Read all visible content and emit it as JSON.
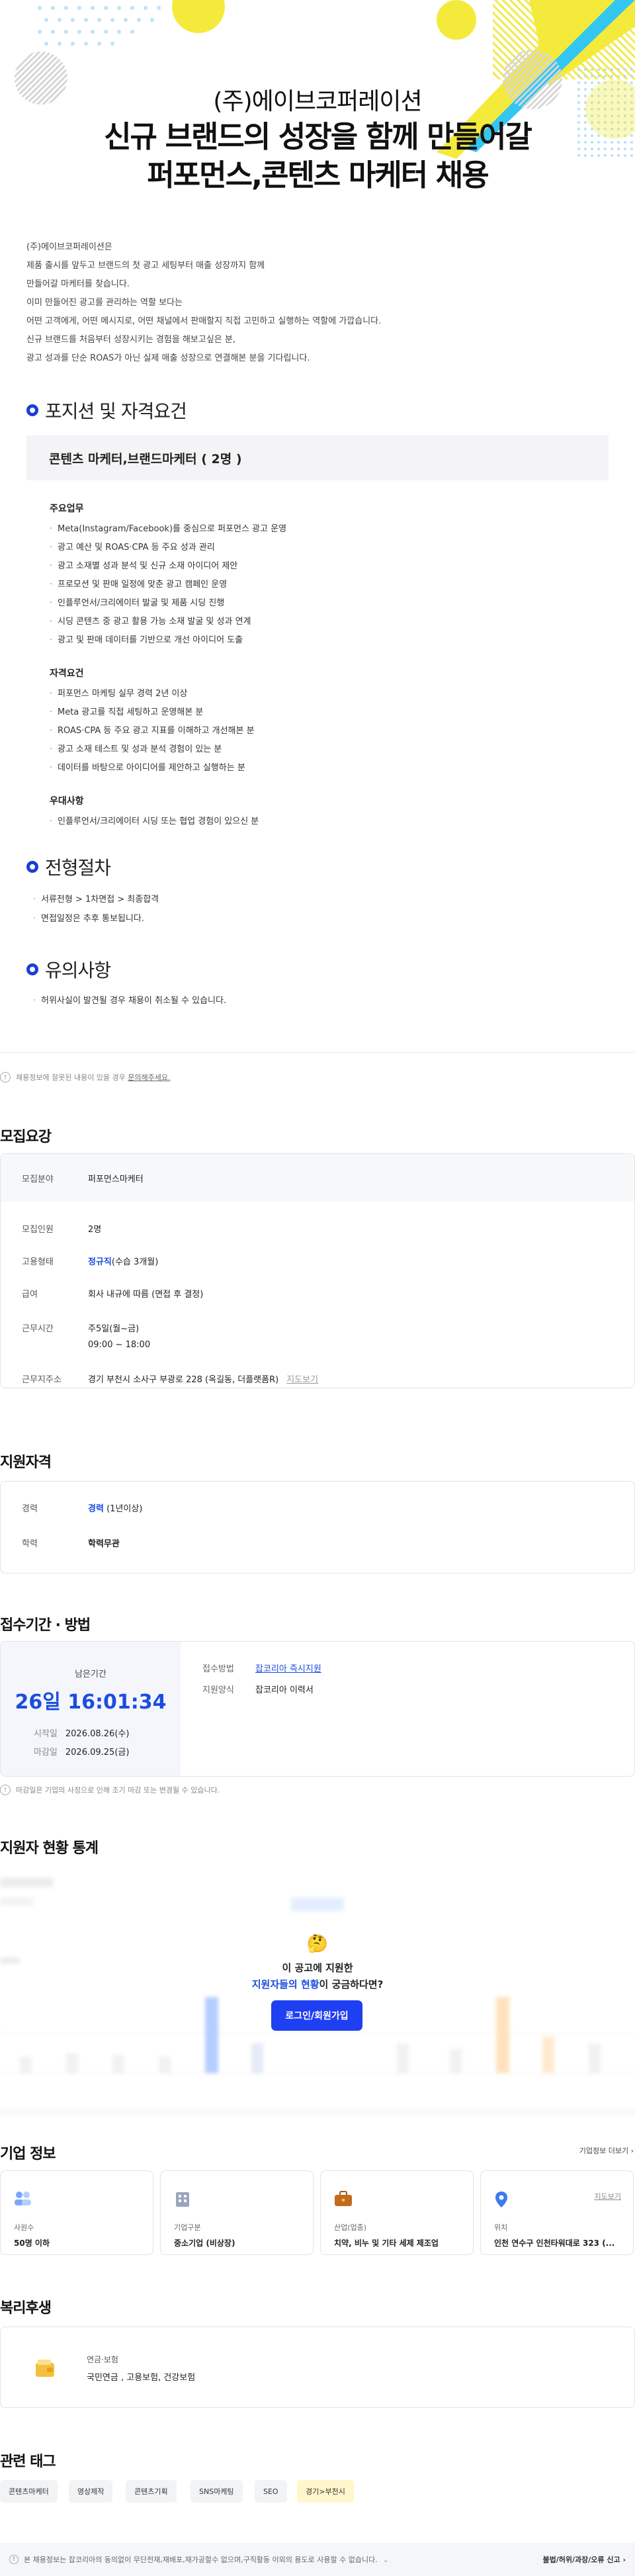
{
  "banner": {
    "company": "(주)에이브코퍼레이션",
    "headline_line1": "신규 브랜드의 성장을 함께 만들어갈",
    "headline_line2": "퍼포먼스,콘텐츠 마케터 채용"
  },
  "intro": {
    "lines": [
      "(주)에이브코퍼레이션은",
      "제품 출시를 앞두고 브랜드의 첫 광고 세팅부터 매출 성장까지 함께",
      "만들어갈 마케터를 찾습니다.",
      "이미 만들어진 광고를 관리하는 역할 보다는",
      "어떤 고객에게, 어떤 메시지로, 어떤 채널에서 판매할지 직접 고민하고 실행하는 역할에 가깝습니다.",
      "신규 브랜드를 처음부터 성장시키는 경험을 해보고싶은 분,",
      "광고 성과를 단순 ROAS가 아닌 실제 매출 성장으로 연결해본 분을 기다립니다."
    ]
  },
  "positions": {
    "heading": "포지션 및 자격요건",
    "role": "콘텐츠 마케터,브랜드마케터 ( 2명 )",
    "duties_title": "주요업무",
    "duties": [
      "Meta(Instagram/Facebook)를 중심으로 퍼포먼스 광고 운영",
      "광고 예산 및 ROAS·CPA 등 주요 성과 관리",
      "광고 소재별 성과 분석 및 신규 소재 아이디어 제안",
      "프로모션 및 판매 일정에 맞춘 광고 캠페인 운영",
      "인플루언서/크리에이터 발굴 및 제품 시딩 진행",
      "시딩 콘텐츠 중 광고 활용 가능 소재 발굴 및 성과 연계",
      "광고 및 판매 데이터를 기반으로 개선 아이디어 도출"
    ],
    "quals_title": "자격요건",
    "quals": [
      "퍼포먼스 마케팅 실무 경력 2년 이상",
      "Meta 광고를 직접 세팅하고 운영해본 분",
      "ROAS·CPA 등 주요 광고 지표를 이해하고 개선해본 분",
      "광고 소재 테스트 및 성과 분석 경험이 있는 분",
      "데이터를 바탕으로 아이디어를 제안하고 실행하는 분"
    ],
    "pref_title": "우대사항",
    "prefs": [
      "인플루언서/크리에이터 시딩 또는 협업 경험이 있으신 분"
    ]
  },
  "process": {
    "heading": "전형절차",
    "items": [
      "서류전형 > 1차면접 > 최종합격",
      "면접일정은 추후 통보됩니다."
    ]
  },
  "caution": {
    "heading": "유의사항",
    "items": [
      "허위사실이 발견될 경우 채용이 취소될 수 있습니다."
    ]
  },
  "report_notice": {
    "text": "채용정보에 잘못된 내용이 있을 경우",
    "link": "문의해주세요."
  },
  "summary": {
    "title": "모집요강",
    "field_k": "모집분야",
    "field_v": "퍼포먼스마케터",
    "count_k": "모집인원",
    "count_v": "2명",
    "type_k": "고용형태",
    "type_v": "정규직",
    "type_sub": "(수습 3개월)",
    "pay_k": "급여",
    "pay_v": "회사 내규에 따름 (면접 후 결정)",
    "hours_k": "근무시간",
    "hours_v1": "주5일(월~금)",
    "hours_v2": "09:00 ~ 18:00",
    "addr_k": "근무지주소",
    "addr_v": "경기 부천시 소사구 부광로 228 (옥길동, 더플랫폼R)",
    "addr_link": "지도보기"
  },
  "qualification": {
    "title": "지원자격",
    "career_k": "경력",
    "career_v": "경력",
    "career_sub": "(1년이상)",
    "edu_k": "학력",
    "edu_v": "학력무관"
  },
  "apply": {
    "title": "접수기간 · 방법",
    "remain_label": "남은기간",
    "remain": "26일 16:01:34",
    "start_k": "시작일",
    "start_v": "2026.08.26(수)",
    "end_k": "마감일",
    "end_v": "2026.09.25(금)",
    "method_k": "접수방법",
    "method_v": "잡코리아 즉시지원",
    "form_k": "지원양식",
    "form_v": "잡코리아 이력서",
    "notice": "마감일은 기업의 사정으로 인해 조기 마감 또는 변경될 수 있습니다."
  },
  "stats": {
    "title": "지원자 현황 통계",
    "emoji": "🤔",
    "q1": "이 공고에 지원한",
    "q2_hl": "지원자들의 현황",
    "q2_rest": "이 궁금하다면?",
    "button": "로그인/회원가입"
  },
  "company": {
    "title": "기업 정보",
    "more": "기업정보 더보기",
    "map_link": "지도보기",
    "cards": [
      {
        "icon": "people-icon",
        "label": "사원수",
        "value": "50명 이하"
      },
      {
        "icon": "building-icon",
        "label": "기업구분",
        "value": "중소기업 (비상장)"
      },
      {
        "icon": "briefcase-icon",
        "label": "산업(업종)",
        "value": "치약, 비누 및 기타 세제 제조업"
      },
      {
        "icon": "pin-icon",
        "label": "위치",
        "value": "인천 연수구 인천타워대로 323 (..."
      }
    ]
  },
  "welfare": {
    "title": "복리후생",
    "category": "연금·보험",
    "items": "국민연금 , 고용보험, 건강보험"
  },
  "tags": {
    "title": "관련 태그",
    "items": [
      "콘텐츠마케터",
      "영상제작",
      "콘텐츠기획",
      "SNS마케팅",
      "SEO",
      "경기>부천시"
    ]
  },
  "footer": {
    "text": "본 채용정보는 잡코리아의 동의없이 무단전재,재배포,재가공할수 없으며,구직활동 이외의 용도로 사용할 수 없습니다.",
    "report": "불법/허위/과장/오류 신고"
  },
  "colors": {
    "accent": "#1b4de0",
    "button": "#1f3ff2",
    "deco_yellow": "#f4ea3c",
    "deco_blue": "#33c6f0"
  }
}
